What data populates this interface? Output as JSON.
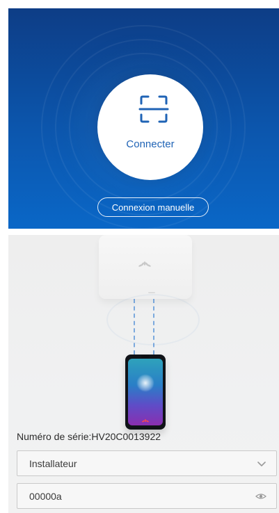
{
  "top": {
    "connect_label": "Connecter",
    "manual_button_label": "Connexion manuelle",
    "scan_icon": "qr-scan-icon"
  },
  "bottom": {
    "serial_text": "Numéro de série:HV20C0013922",
    "role_select_value": "Installateur",
    "password_value": "00000a",
    "role_select_icon": "chevron-down-icon",
    "password_icon": "eye-icon"
  },
  "colors": {
    "top_bg_dark": "#0d3d86",
    "top_bg_light": "#0a67c7",
    "connect_text": "#1f63b5",
    "white": "#ffffff",
    "field_border": "#c9c9c9"
  }
}
